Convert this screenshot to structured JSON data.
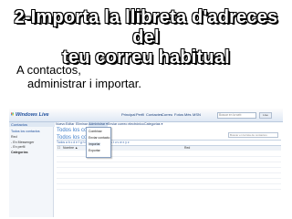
{
  "slide": {
    "title_line1": "2-Importa la llibreta d'adreces del",
    "title_line2": "teu correu habitual",
    "bullet_line1": "A contactos,",
    "bullet_line2": "administrar i importar."
  },
  "screenshot": {
    "logo": "Windows Live",
    "nav": [
      "Principal",
      "Perfil",
      "Contactes",
      "Correu",
      "Fotos",
      "Més",
      "MSN"
    ],
    "search_placeholder": "Buscar en la web",
    "badge": "Live",
    "sidebar_header": "Contactos",
    "sidebar_items": [
      "Todos los contactos",
      "Red",
      "- En Messenger",
      "- En perfil",
      "Categorías"
    ],
    "toolbar": [
      "Nuevo",
      "Editar",
      "Eliminar",
      "Administrar ▾",
      "Enviar correo electrónico",
      "Categorías ▾"
    ],
    "page_heading": "Todos los contac",
    "dropdown_options": [
      "Combinar",
      "Enviar contacto",
      "Importar",
      "Exportar"
    ],
    "contacts_search_placeholder": "Buscar en la lista de contactos",
    "alpha_bar": "Todos  a b c d e f g h i j k l m n ñ o p q r s t u v w x y z",
    "column_headers": [
      "Nombre ▲",
      "Red"
    ],
    "footer_label": "Todos"
  },
  "colors": {
    "title_fill": "#ffffff",
    "title_outline": "#000000",
    "live_blue": "#1f4f9c",
    "heading_blue": "#3d7cc9"
  }
}
